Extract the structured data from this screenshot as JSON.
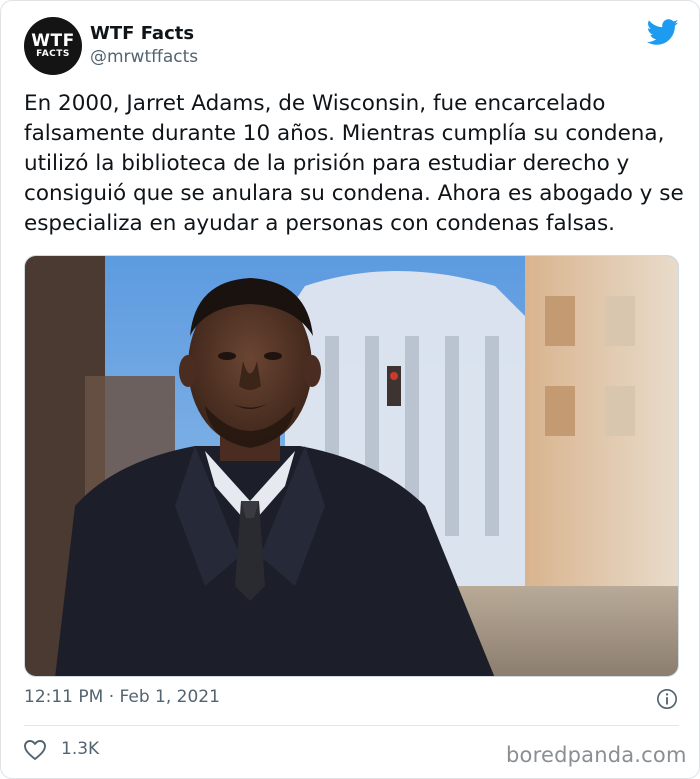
{
  "tweet": {
    "avatar": {
      "line1": "WTF",
      "line2": "FACTS"
    },
    "display_name": "WTF Facts",
    "handle": "@mrwtffacts",
    "text": "En 2000, Jarret Adams, de Wisconsin, fue encarcelado falsamente durante 10 años. Mientras cumplía su condena, utilizó la biblioteca de la prisión para estudiar derecho y consiguió que se anulara su condena. Ahora es abogado y se especializa en ayudar a personas con condenas falsas.",
    "timestamp": "12:11 PM · Feb 1, 2021",
    "likes": "1.3K"
  },
  "icons": {
    "brand": "twitter-bird-icon",
    "info": "info-icon",
    "like": "heart-icon"
  },
  "colors": {
    "twitter_blue": "#1d9bf0",
    "text_primary": "#0f1419",
    "text_secondary": "#536471"
  },
  "watermark": "boredpanda.com"
}
